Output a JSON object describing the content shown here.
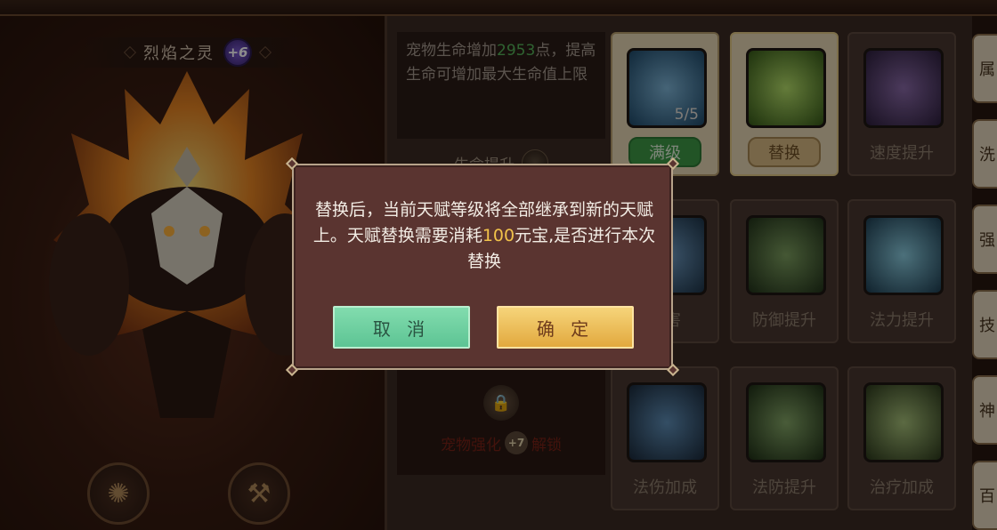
{
  "pet": {
    "name": "烈焰之灵",
    "level_badge": "+6"
  },
  "talent_detail": {
    "desc_prefix": "宠物生命增加",
    "desc_value": "2953",
    "desc_suffix": "点，提高生命可增加最大生命值上限",
    "title": "生命提升"
  },
  "locked_slot": {
    "text_before": "宠物强化",
    "badge": "+7",
    "text_after": "解锁"
  },
  "talents": [
    {
      "label": "满级",
      "level": "5/5",
      "style": "green",
      "icon": "water-swirl-icon"
    },
    {
      "label": "替换",
      "style": "tan",
      "icon": "heart-up-icon"
    },
    {
      "label": "速度提升",
      "icon": "boot-icon"
    },
    {
      "label": "伤害",
      "icon": "splash-icon"
    },
    {
      "label": "防御提升",
      "icon": "shield-icon"
    },
    {
      "label": "法力提升",
      "icon": "mana-drop-icon"
    },
    {
      "label": "法伤加成",
      "icon": "magic-spike-icon"
    },
    {
      "label": "法防提升",
      "icon": "magic-armor-icon"
    },
    {
      "label": "治疗加成",
      "icon": "heal-heart-icon"
    }
  ],
  "side_tabs": [
    "属",
    "洗",
    "强",
    "技",
    "神",
    "百"
  ],
  "dialog": {
    "message_1": "替换后，当前天赋等级将全部继承到新的天赋上。天赋替换需要消耗",
    "cost": "100",
    "message_2": "元宝,是否进行本次替换",
    "cancel_label": "取 消",
    "confirm_label": "确 定"
  },
  "colors": {
    "dialog_bg": "#5a3430",
    "cancel": "#6fd1a1",
    "confirm": "#efc05a",
    "highlight": "#f1c24a"
  }
}
